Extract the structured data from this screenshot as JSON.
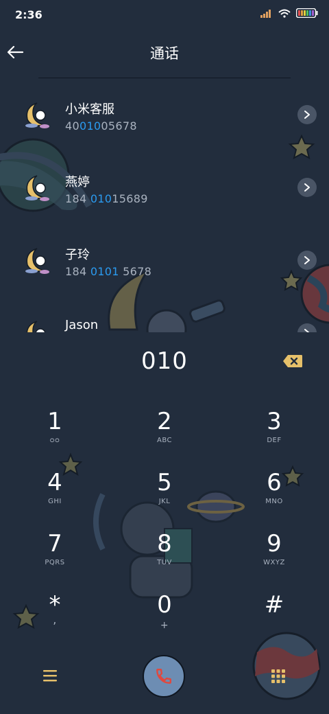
{
  "status_bar": {
    "time": "2:36",
    "icons": [
      "signal-icon",
      "wifi-icon",
      "battery-icon"
    ]
  },
  "header": {
    "title": "通话",
    "back_icon": "back-arrow-icon"
  },
  "contacts": [
    {
      "name": "小米客服",
      "number_pre": "40",
      "number_hl": "010",
      "number_post": "05678"
    },
    {
      "name": "燕婷",
      "number_pre": "184 ",
      "number_hl": "010",
      "number_post": "15689"
    },
    {
      "name": "子玲",
      "number_pre": "184 ",
      "number_hl": "0101",
      "number_post": " 5678"
    },
    {
      "name": "Jason",
      "number_pre": "",
      "number_hl": "",
      "number_post": ""
    }
  ],
  "dialer": {
    "input": "010",
    "keys": [
      {
        "digit": "1",
        "letters": "ᴑᴑ"
      },
      {
        "digit": "2",
        "letters": "ABC"
      },
      {
        "digit": "3",
        "letters": "DEF"
      },
      {
        "digit": "4",
        "letters": "GHI"
      },
      {
        "digit": "5",
        "letters": "JKL"
      },
      {
        "digit": "6",
        "letters": "MNO"
      },
      {
        "digit": "7",
        "letters": "PQRS"
      },
      {
        "digit": "8",
        "letters": "TUV"
      },
      {
        "digit": "9",
        "letters": "WXYZ"
      },
      {
        "digit": "*",
        "letters": ","
      },
      {
        "digit": "0",
        "letters": "+"
      },
      {
        "digit": "#",
        "letters": ""
      }
    ]
  },
  "colors": {
    "background": "#222d3d",
    "highlight": "#2b9bf0",
    "accent_gold": "#e6c06a",
    "call_button": "#6d8db3",
    "call_icon": "#e0483e"
  }
}
